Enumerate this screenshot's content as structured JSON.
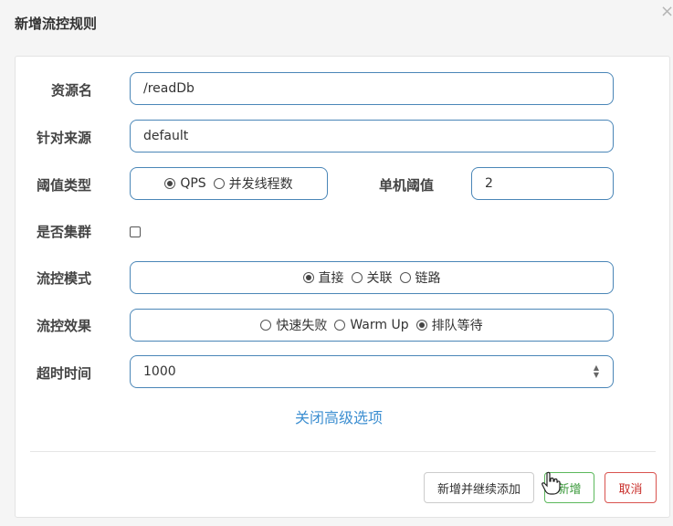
{
  "dialog": {
    "title": "新增流控规则",
    "close_label": "×"
  },
  "form": {
    "resource": {
      "label": "资源名",
      "value": "/readDb"
    },
    "limit_app": {
      "label": "针对来源",
      "value": "default"
    },
    "threshold_type": {
      "label": "阈值类型",
      "options": [
        {
          "label": "QPS",
          "selected": true
        },
        {
          "label": "并发线程数",
          "selected": false
        }
      ]
    },
    "single_threshold": {
      "label": "单机阈值",
      "value": "2"
    },
    "cluster": {
      "label": "是否集群",
      "checked": false
    },
    "flow_mode": {
      "label": "流控模式",
      "options": [
        {
          "label": "直接",
          "selected": true
        },
        {
          "label": "关联",
          "selected": false
        },
        {
          "label": "链路",
          "selected": false
        }
      ]
    },
    "control_behavior": {
      "label": "流控效果",
      "options": [
        {
          "label": "快速失败",
          "selected": false
        },
        {
          "label": "Warm Up",
          "selected": false
        },
        {
          "label": "排队等待",
          "selected": true
        }
      ]
    },
    "timeout": {
      "label": "超时时间",
      "value": "1000"
    },
    "advanced_toggle": "关闭高级选项"
  },
  "footer": {
    "add_continue_label": "新增并继续添加",
    "add_label": "新增",
    "cancel_label": "取消"
  },
  "colors": {
    "input_border": "#4a86b7",
    "link": "#3d8fd1",
    "success": "#5cb85c",
    "danger": "#d9534f"
  }
}
